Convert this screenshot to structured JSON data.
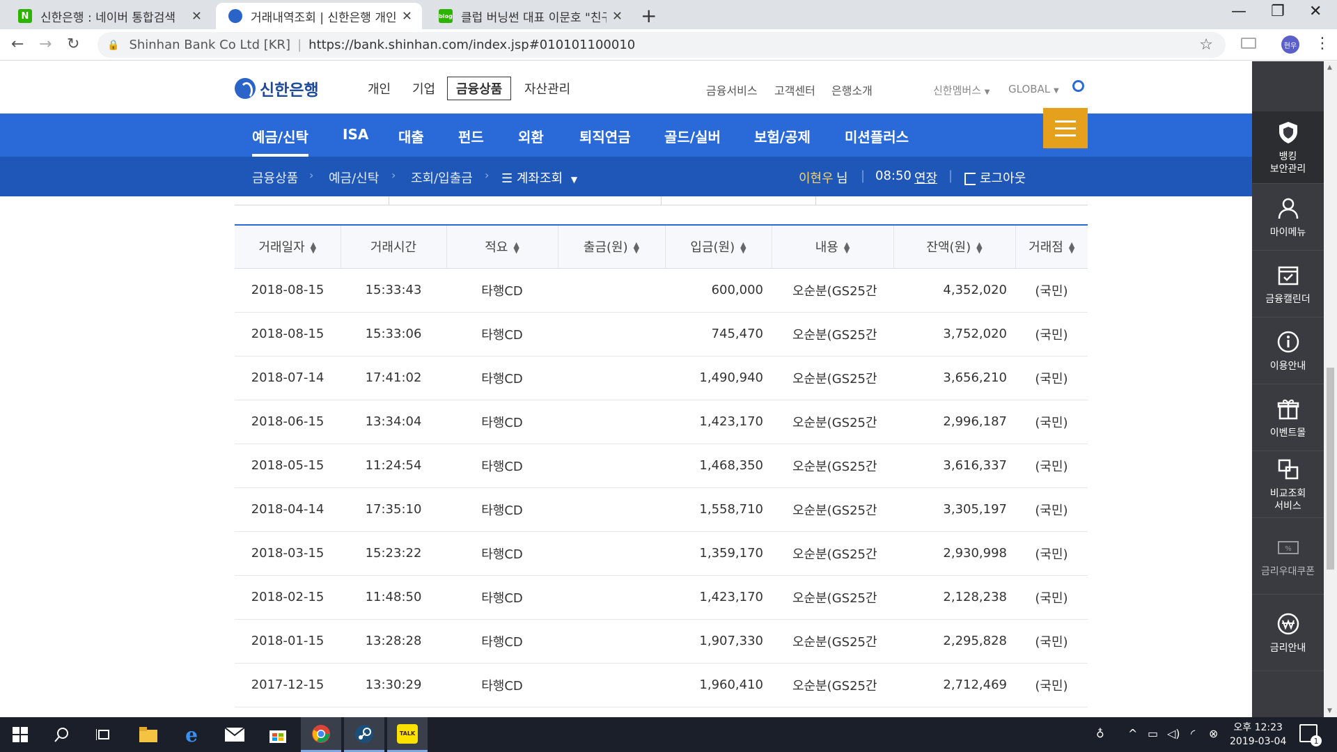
{
  "browser": {
    "tabs": [
      {
        "title": "신한은행 : 네이버 통합검색",
        "favicon": "naver-icon"
      },
      {
        "title": "거래내역조회 | 신한은행 개인뱅",
        "favicon": "shinhan-icon"
      },
      {
        "title": "클럽 버닝썬 대표 이문호 \"친구 (",
        "favicon": "blog-icon"
      }
    ],
    "site_name": "Shinhan Bank Co Ltd [KR]",
    "url": "https://bank.shinhan.com/index.jsp#010101100010",
    "profile": "현우"
  },
  "header": {
    "logo_text": "신한은행",
    "top_nav": [
      "개인",
      "기업",
      "금융상품",
      "자산관리"
    ],
    "active_top_nav": "금융상품",
    "util_nav": [
      "금융서비스",
      "고객센터",
      "은행소개"
    ],
    "member_label": "신한멤버스",
    "global_label": "GLOBAL"
  },
  "main_nav": [
    "예금/신탁",
    "ISA",
    "대출",
    "펀드",
    "외환",
    "퇴직연금",
    "골드/실버",
    "보험/공제",
    "미션플러스"
  ],
  "breadcrumb": [
    "금융상품",
    "예금/신탁",
    "조회/입출금",
    "계좌조회"
  ],
  "session": {
    "user": "이현우",
    "honorific": "님",
    "timer": "08:50",
    "extend_label": "연장",
    "logout_label": "로그아웃"
  },
  "table": {
    "columns": [
      "거래일자",
      "거래시간",
      "적요",
      "출금(원)",
      "입금(원)",
      "내용",
      "잔액(원)",
      "거래점"
    ],
    "sortable": [
      true,
      false,
      true,
      true,
      true,
      true,
      true,
      true
    ],
    "rows": [
      {
        "date": "2018-08-15",
        "time": "15:33:43",
        "type": "타행CD",
        "withdraw": "",
        "deposit": "600,000",
        "memo": "오순분(GS25간",
        "balance": "4,352,020",
        "branch": "(국민)"
      },
      {
        "date": "2018-08-15",
        "time": "15:33:06",
        "type": "타행CD",
        "withdraw": "",
        "deposit": "745,470",
        "memo": "오순분(GS25간",
        "balance": "3,752,020",
        "branch": "(국민)"
      },
      {
        "date": "2018-07-14",
        "time": "17:41:02",
        "type": "타행CD",
        "withdraw": "",
        "deposit": "1,490,940",
        "memo": "오순분(GS25간",
        "balance": "3,656,210",
        "branch": "(국민)"
      },
      {
        "date": "2018-06-15",
        "time": "13:34:04",
        "type": "타행CD",
        "withdraw": "",
        "deposit": "1,423,170",
        "memo": "오순분(GS25간",
        "balance": "2,996,187",
        "branch": "(국민)"
      },
      {
        "date": "2018-05-15",
        "time": "11:24:54",
        "type": "타행CD",
        "withdraw": "",
        "deposit": "1,468,350",
        "memo": "오순분(GS25간",
        "balance": "3,616,337",
        "branch": "(국민)"
      },
      {
        "date": "2018-04-14",
        "time": "17:35:10",
        "type": "타행CD",
        "withdraw": "",
        "deposit": "1,558,710",
        "memo": "오순분(GS25간",
        "balance": "3,305,197",
        "branch": "(국민)"
      },
      {
        "date": "2018-03-15",
        "time": "15:23:22",
        "type": "타행CD",
        "withdraw": "",
        "deposit": "1,359,170",
        "memo": "오순분(GS25간",
        "balance": "2,930,998",
        "branch": "(국민)"
      },
      {
        "date": "2018-02-15",
        "time": "11:48:50",
        "type": "타행CD",
        "withdraw": "",
        "deposit": "1,423,170",
        "memo": "오순분(GS25간",
        "balance": "2,128,238",
        "branch": "(국민)"
      },
      {
        "date": "2018-01-15",
        "time": "13:28:28",
        "type": "타행CD",
        "withdraw": "",
        "deposit": "1,907,330",
        "memo": "오순분(GS25간",
        "balance": "2,295,828",
        "branch": "(국민)"
      },
      {
        "date": "2017-12-15",
        "time": "13:30:29",
        "type": "타행CD",
        "withdraw": "",
        "deposit": "1,960,410",
        "memo": "오순분(GS25간",
        "balance": "2,712,469",
        "branch": "(국민)"
      }
    ]
  },
  "side_panel": [
    {
      "label": "뱅킹\n보안관리",
      "icon": "shield-icon"
    },
    {
      "label": "마이메뉴",
      "icon": "person-icon"
    },
    {
      "label": "금융캘린더",
      "icon": "calendar-check-icon"
    },
    {
      "label": "이용안내",
      "icon": "info-icon"
    },
    {
      "label": "이벤트몰",
      "icon": "gift-icon"
    },
    {
      "label": "비교조회\n서비스",
      "icon": "compare-icon"
    },
    {
      "label": "금리우대쿠폰",
      "icon": "coupon-icon"
    },
    {
      "label": "금리안내",
      "icon": "won-icon"
    }
  ],
  "taskbar": {
    "time_ampm": "오후 12:23",
    "date": "2019-03-04",
    "notification_count": "1"
  },
  "colors": {
    "brand_blue": "#2a6ad8",
    "sub_blue": "#1f57b8",
    "menu_orange": "#e5a01c",
    "side_dark": "#3a3b40"
  }
}
